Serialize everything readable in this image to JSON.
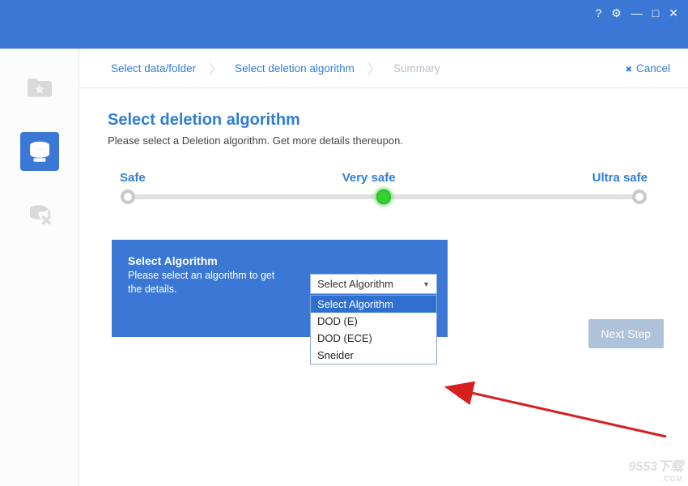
{
  "titlebar": {
    "help": "?",
    "settings": "⚙",
    "minimize": "—",
    "maximize": "□",
    "close": "✕"
  },
  "breadcrumb": {
    "step1": "Select data/folder",
    "step2": "Select deletion algorithm",
    "step3": "Summary",
    "cancel": "Cancel"
  },
  "page": {
    "title": "Select deletion algorithm",
    "subtitle": "Please select a Deletion algorithm. Get more details thereupon."
  },
  "slider": {
    "safe": "Safe",
    "very_safe": "Very safe",
    "ultra_safe": "Ultra safe"
  },
  "panel": {
    "heading": "Select Algorithm",
    "subtext": "Please select an algorithm to get the details."
  },
  "select": {
    "current": "Select Algorithm",
    "options": [
      "Select Algorithm",
      "DOD (E)",
      "DOD (ECE)",
      "Sneider"
    ]
  },
  "buttons": {
    "next": "Next Step"
  },
  "watermark": {
    "text": "9553下载",
    "sub": ".COM"
  }
}
